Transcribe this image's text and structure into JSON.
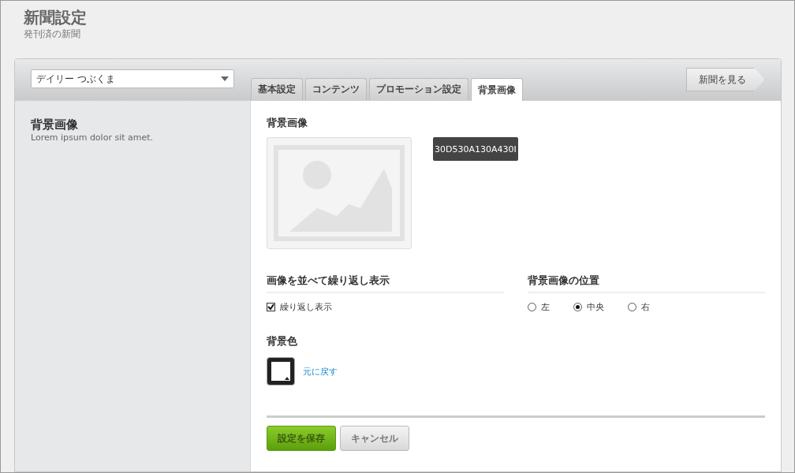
{
  "header": {
    "title": "新聞設定",
    "subtitle": "発刊済の新聞"
  },
  "newspaper_select": {
    "value": "デイリー つぶくま"
  },
  "tabs": [
    {
      "label": "基本設定",
      "selected": false
    },
    {
      "label": "コンテンツ",
      "selected": false
    },
    {
      "label": "プロモーション設定",
      "selected": false
    },
    {
      "label": "背景画像",
      "selected": true
    }
  ],
  "view_button": "新聞を見る",
  "sidebar": {
    "title": "背景画像",
    "description": "Lorem ipsum dolor sit amet."
  },
  "background_image": {
    "label": "背景画像",
    "tooltip": "30D530A130A430I"
  },
  "repeat": {
    "heading": "画像を並べて繰り返し表示",
    "label": "繰り返し表示",
    "checked": true
  },
  "position": {
    "heading": "背景画像の位置",
    "options": [
      {
        "label": "左",
        "selected": false
      },
      {
        "label": "中央",
        "selected": true
      },
      {
        "label": "右",
        "selected": false
      }
    ]
  },
  "background_color": {
    "heading": "背景色",
    "color": "#ffffff",
    "reset_link": "元に戻す"
  },
  "buttons": {
    "save": "設定を保存",
    "cancel": "キャンセル"
  }
}
